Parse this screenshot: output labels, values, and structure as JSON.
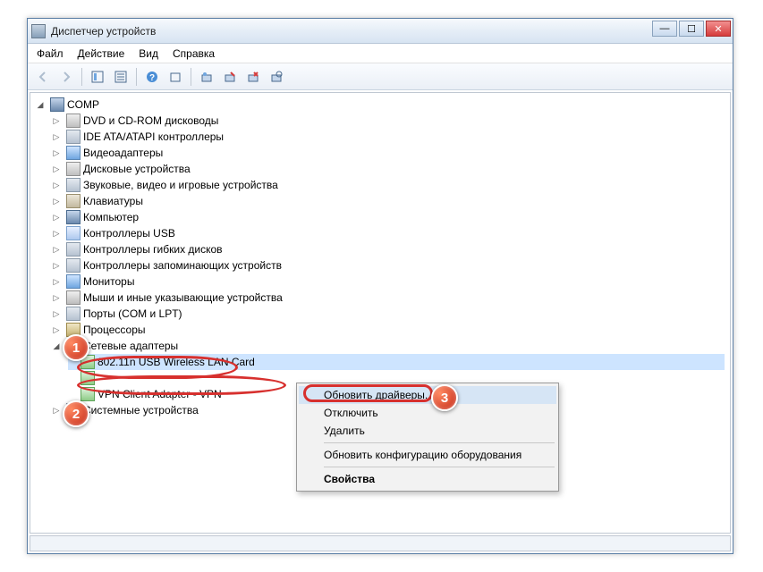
{
  "window": {
    "title": "Диспетчер устройств",
    "controls": {
      "min": "—",
      "max": "☐",
      "close": "✕"
    }
  },
  "menu": {
    "file": "Файл",
    "action": "Действие",
    "view": "Вид",
    "help": "Справка"
  },
  "tree": {
    "root": "COMP",
    "items": [
      "DVD и CD-ROM дисководы",
      "IDE ATA/ATAPI контроллеры",
      "Видеоадаптеры",
      "Дисковые устройства",
      "Звуковые, видео и игровые устройства",
      "Клавиатуры",
      "Компьютер",
      "Контроллеры USB",
      "Контроллеры гибких дисков",
      "Контроллеры запоминающих устройств",
      "Мониторы",
      "Мыши и иные указывающие устройства",
      "Порты (COM и LPT)",
      "Процессоры",
      "Сетевые адаптеры"
    ],
    "net_children": [
      "802.11n USB Wireless LAN Card",
      "",
      "VPN Client Adapter - VPN"
    ],
    "after": "Системные устройства"
  },
  "context_menu": {
    "update": "Обновить драйверы...",
    "disable": "Отключить",
    "uninstall": "Удалить",
    "scan": "Обновить конфигурацию оборудования",
    "properties": "Свойства"
  },
  "badges": {
    "b1": "1",
    "b2": "2",
    "b3": "3"
  }
}
